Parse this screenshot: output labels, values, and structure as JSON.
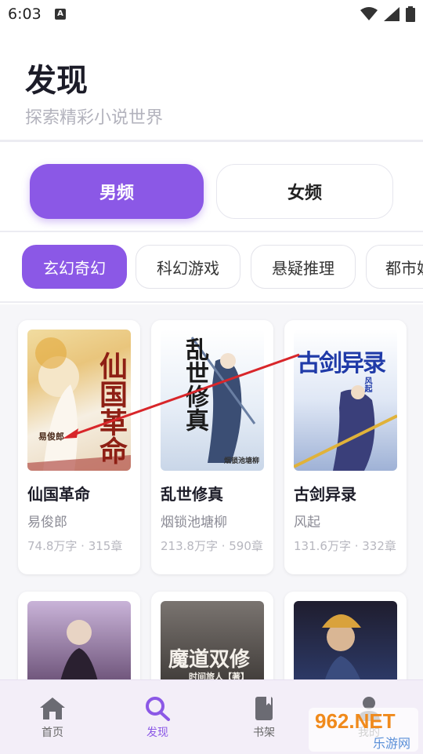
{
  "status_bar": {
    "time": "6:03",
    "notification_icon": "A"
  },
  "header": {
    "title": "发现",
    "subtitle": "探索精彩小说世界"
  },
  "gender_tabs": [
    {
      "label": "男频",
      "active": true
    },
    {
      "label": "女频",
      "active": false
    }
  ],
  "categories": [
    {
      "label": "玄幻奇幻",
      "active": true
    },
    {
      "label": "科幻游戏",
      "active": false
    },
    {
      "label": "悬疑推理",
      "active": false
    },
    {
      "label": "都市娱",
      "active": false
    }
  ],
  "books": [
    {
      "title": "仙国革命",
      "author": "易俊郎",
      "meta": "74.8万字 · 315章",
      "cover_text": "仙国革命",
      "cover_author": "易俊郎"
    },
    {
      "title": "乱世修真",
      "author": "烟锁池塘柳",
      "meta": "213.8万字 · 590章",
      "cover_text": "乱世修真",
      "cover_author": "烟锁池塘柳"
    },
    {
      "title": "古剑异录",
      "author": "风起",
      "meta": "131.6万字 · 332章",
      "cover_text": "古剑异录",
      "cover_author": "风起"
    },
    {
      "cover_text": "",
      "cover_author": ""
    },
    {
      "cover_text": "魔道双修",
      "cover_author": "时间旅人【著】"
    },
    {
      "cover_text": "",
      "cover_author": ""
    }
  ],
  "bottom_nav": [
    {
      "label": "首页",
      "icon": "home-icon",
      "active": false
    },
    {
      "label": "发现",
      "icon": "search-icon",
      "active": true
    },
    {
      "label": "书架",
      "icon": "book-icon",
      "active": false
    },
    {
      "label": "我的",
      "icon": "person-icon",
      "active": false
    }
  ],
  "watermark": {
    "brand": "962.NET",
    "sub": "乐游网"
  },
  "colors": {
    "accent": "#8b58e6",
    "nav_bg": "#f3eef8"
  }
}
